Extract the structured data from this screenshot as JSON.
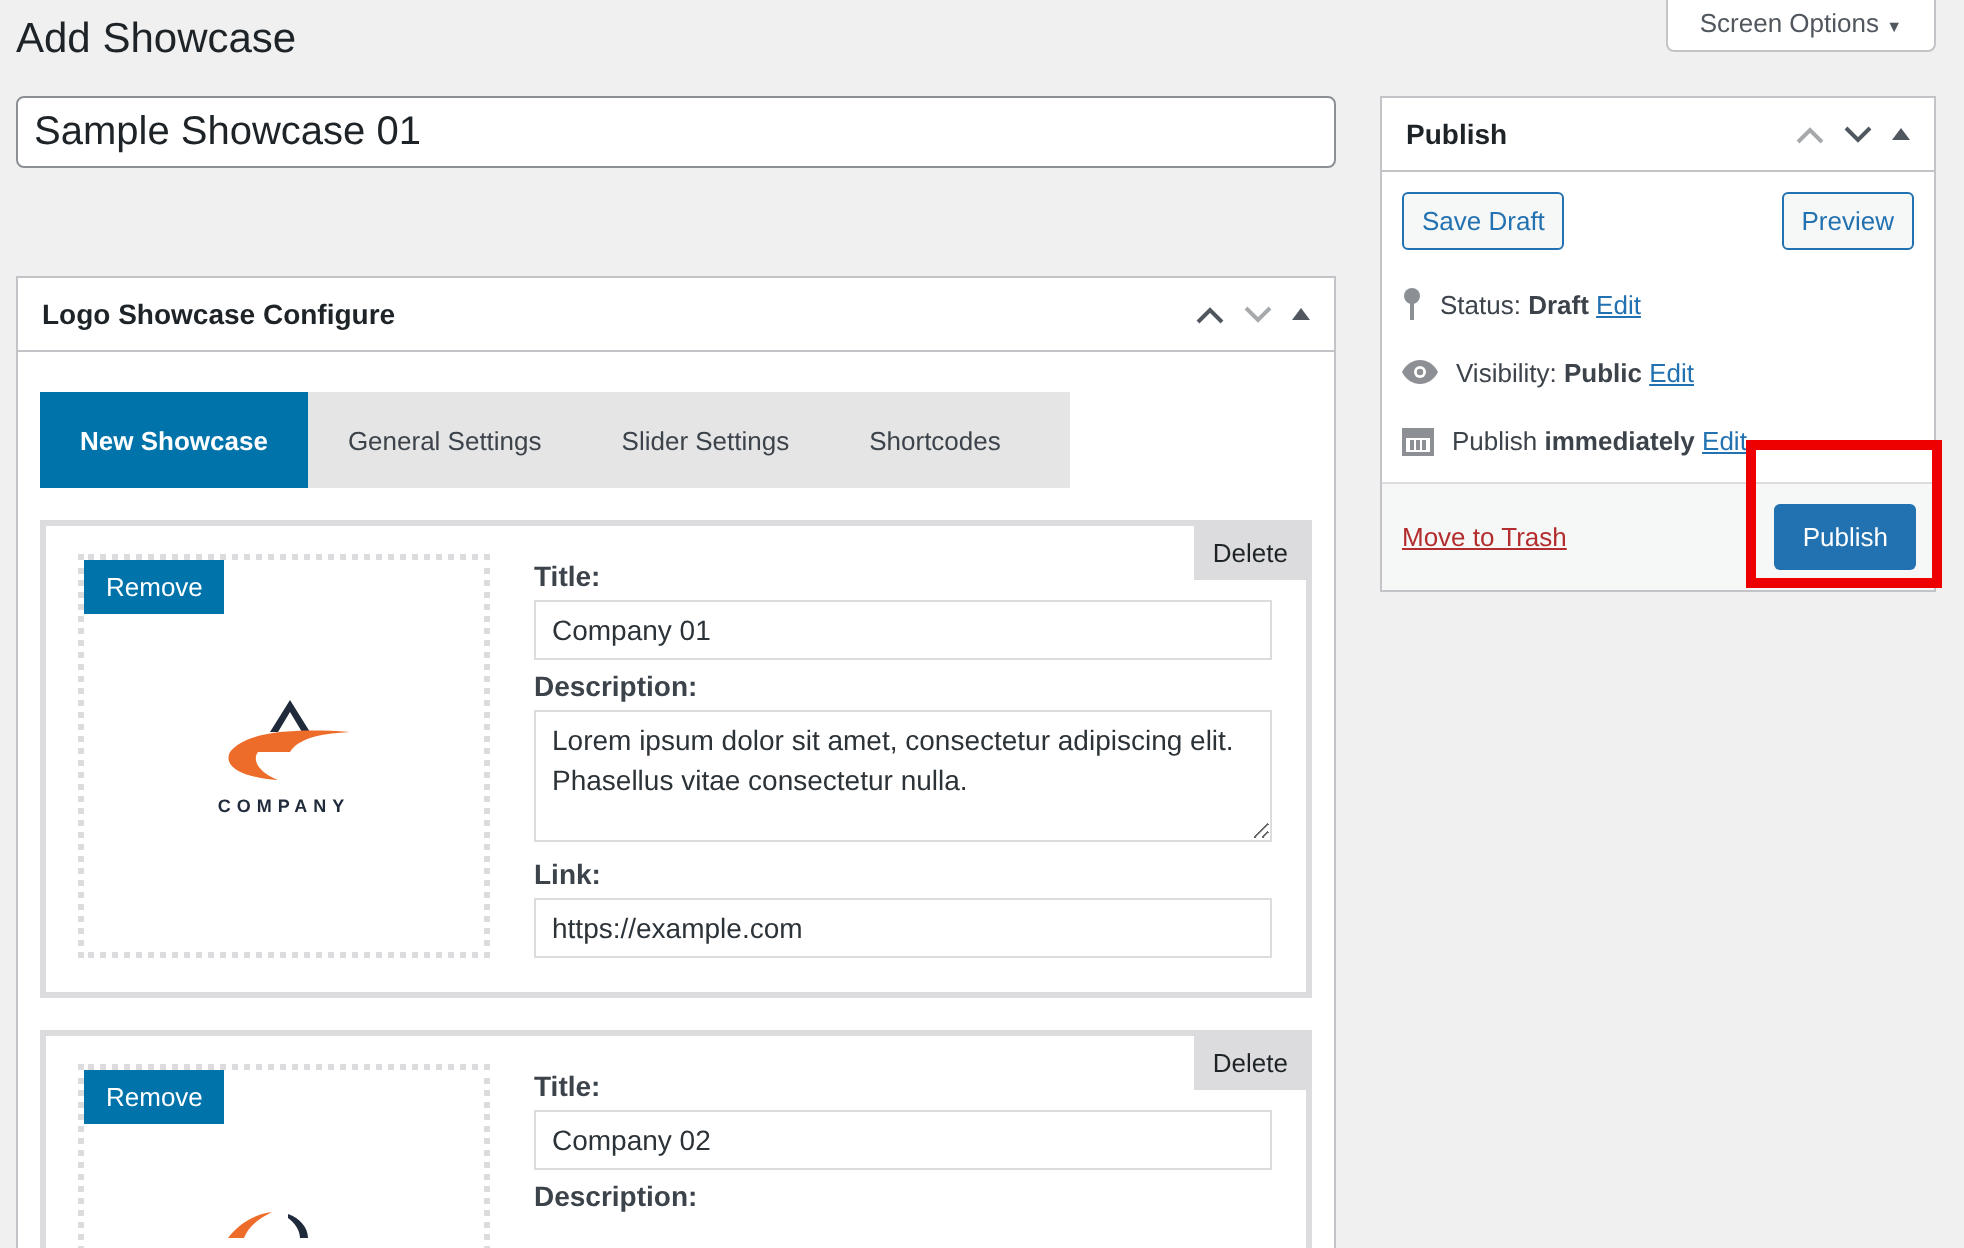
{
  "page_title": "Add Showcase",
  "screen_options": {
    "label": "Screen Options",
    "caret": "▼"
  },
  "title_field": {
    "value": "Sample Showcase 01"
  },
  "configure_box": {
    "title": "Logo Showcase Configure",
    "tabs": [
      {
        "label": "New Showcase",
        "selected": true
      },
      {
        "label": "General Settings",
        "selected": false
      },
      {
        "label": "Slider Settings",
        "selected": false
      },
      {
        "label": "Shortcodes",
        "selected": false
      }
    ],
    "items": [
      {
        "delete": "Delete",
        "remove": "Remove",
        "logo": {
          "kind": "full",
          "name": "COMPANY"
        },
        "title_label": "Title:",
        "title": "Company 01",
        "description_label": "Description:",
        "description": "Lorem ipsum dolor sit amet, consectetur adipiscing elit. Phasellus vitae consectetur nulla.",
        "link_label": "Link:",
        "link": "https://example.com"
      },
      {
        "delete": "Delete",
        "remove": "Remove",
        "logo": {
          "kind": "partial"
        },
        "title_label": "Title:",
        "title": "Company 02",
        "description_label": "Description:"
      }
    ]
  },
  "publish_box": {
    "title": "Publish",
    "save_draft": "Save Draft",
    "preview": "Preview",
    "rows": [
      {
        "kind": "status",
        "label": "Status:",
        "value": "Draft",
        "edit": "Edit"
      },
      {
        "kind": "visibility",
        "label": "Visibility:",
        "value": "Public",
        "edit": "Edit"
      },
      {
        "kind": "schedule",
        "label": "Publish",
        "value": "immediately",
        "edit": "Edit"
      }
    ],
    "trash": "Move to Trash",
    "publish": "Publish",
    "highlighted": true
  }
}
